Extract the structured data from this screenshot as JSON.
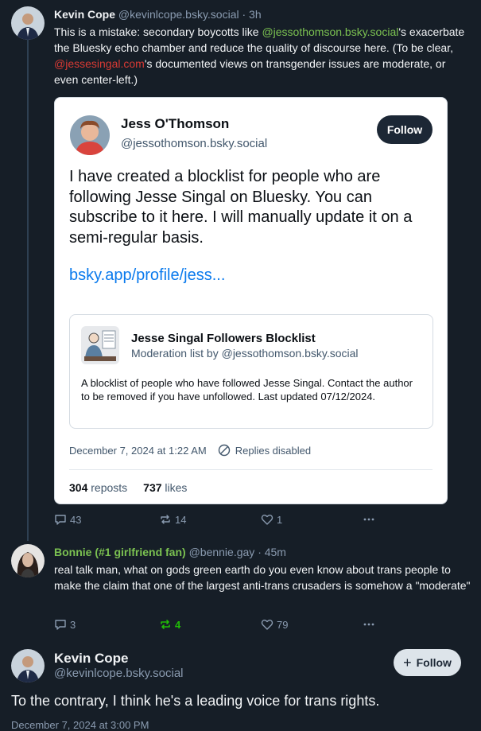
{
  "post1": {
    "author": "Kevin Cope",
    "handle": "@kevinlcope.bsky.social",
    "time": "· 3h",
    "text_a": "This is a mistake: secondary boycotts like ",
    "mention_a": "@jessothomson.bsky.social",
    "text_b": "'s exacerbate the Bluesky echo chamber and reduce the quality of discourse here. (To be clear, ",
    "mention_b": "@jessesingal.com",
    "text_c": "'s documented views on transgender issues are moderate, or even center-left.)",
    "actions": {
      "replies": "43",
      "reposts": "14",
      "likes": "1"
    }
  },
  "embed": {
    "author": "Jess O'Thomson",
    "handle": "@jessothomson.bsky.social",
    "follow_label": "Follow",
    "text": "I have created a blocklist for people who are following Jesse Singal on Bluesky. You can subscribe to it here. I will manually update it on a semi-regular basis.",
    "link": "bsky.app/profile/jess...",
    "list": {
      "title": "Jesse Singal Followers Blocklist",
      "subtitle": "Moderation list by @jessothomson.bsky.social",
      "description": "A blocklist of people who have followed Jesse Singal. Contact the author to be removed if you have unfollowed. Last updated 07/12/2024."
    },
    "date": "December 7, 2024 at 1:22 AM",
    "replies_status": "Replies disabled",
    "reposts_count": "304",
    "reposts_label": "reposts",
    "likes_count": "737",
    "likes_label": "likes"
  },
  "post2": {
    "author": "Bonnie (#1 girlfriend fan)",
    "handle": "@bennie.gay",
    "time": "· 45m",
    "text": "real talk man, what on gods green earth do you even know about trans people to make the claim that one of the largest anti-trans crusaders is somehow a \"moderate\"",
    "actions": {
      "replies": "3",
      "reposts": "4",
      "likes": "79"
    }
  },
  "main": {
    "author": "Kevin Cope",
    "handle": "@kevinlcope.bsky.social",
    "follow_label": "Follow",
    "text": "To the contrary, I think he's a leading voice for trans rights.",
    "date": "December 7, 2024 at 3:00 PM"
  },
  "colors": {
    "background": "#161e27",
    "mention": "#7bc151",
    "link": "#0a7aed",
    "repost_active": "#20bc07"
  }
}
